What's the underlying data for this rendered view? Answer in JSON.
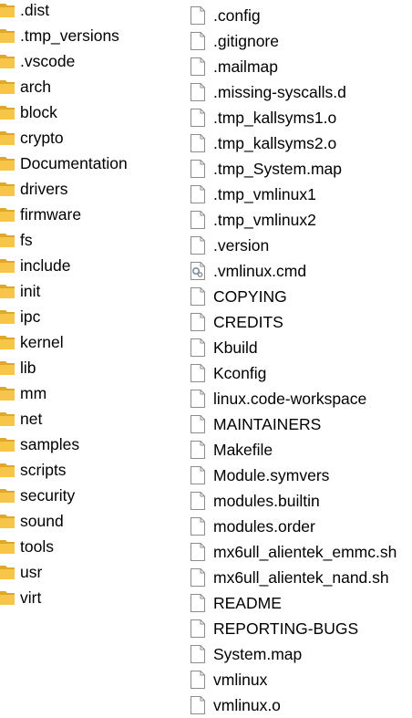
{
  "folders": [
    {
      "name": ".dist",
      "icon": "folder-icon"
    },
    {
      "name": ".tmp_versions",
      "icon": "folder-icon"
    },
    {
      "name": ".vscode",
      "icon": "folder-icon"
    },
    {
      "name": "arch",
      "icon": "folder-icon"
    },
    {
      "name": "block",
      "icon": "folder-icon"
    },
    {
      "name": "crypto",
      "icon": "folder-icon"
    },
    {
      "name": "Documentation",
      "icon": "folder-icon"
    },
    {
      "name": "drivers",
      "icon": "folder-icon"
    },
    {
      "name": "firmware",
      "icon": "folder-icon"
    },
    {
      "name": "fs",
      "icon": "folder-icon"
    },
    {
      "name": "include",
      "icon": "folder-icon"
    },
    {
      "name": "init",
      "icon": "folder-icon"
    },
    {
      "name": "ipc",
      "icon": "folder-icon"
    },
    {
      "name": "kernel",
      "icon": "folder-icon"
    },
    {
      "name": "lib",
      "icon": "folder-icon"
    },
    {
      "name": "mm",
      "icon": "folder-icon"
    },
    {
      "name": "net",
      "icon": "folder-icon"
    },
    {
      "name": "samples",
      "icon": "folder-icon"
    },
    {
      "name": "scripts",
      "icon": "folder-icon"
    },
    {
      "name": "security",
      "icon": "folder-icon"
    },
    {
      "name": "sound",
      "icon": "folder-icon"
    },
    {
      "name": "tools",
      "icon": "folder-icon"
    },
    {
      "name": "usr",
      "icon": "folder-icon"
    },
    {
      "name": "virt",
      "icon": "folder-icon"
    }
  ],
  "files": [
    {
      "name": ".config",
      "icon": "file-icon"
    },
    {
      "name": ".gitignore",
      "icon": "file-icon"
    },
    {
      "name": ".mailmap",
      "icon": "file-icon"
    },
    {
      "name": ".missing-syscalls.d",
      "icon": "file-icon"
    },
    {
      "name": ".tmp_kallsyms1.o",
      "icon": "file-icon"
    },
    {
      "name": ".tmp_kallsyms2.o",
      "icon": "file-icon"
    },
    {
      "name": ".tmp_System.map",
      "icon": "file-icon"
    },
    {
      "name": ".tmp_vmlinux1",
      "icon": "file-icon"
    },
    {
      "name": ".tmp_vmlinux2",
      "icon": "file-icon"
    },
    {
      "name": ".version",
      "icon": "file-icon"
    },
    {
      "name": ".vmlinux.cmd",
      "icon": "cmd-file-icon"
    },
    {
      "name": "COPYING",
      "icon": "file-icon"
    },
    {
      "name": "CREDITS",
      "icon": "file-icon"
    },
    {
      "name": "Kbuild",
      "icon": "file-icon"
    },
    {
      "name": "Kconfig",
      "icon": "file-icon"
    },
    {
      "name": "linux.code-workspace",
      "icon": "file-icon"
    },
    {
      "name": "MAINTAINERS",
      "icon": "file-icon"
    },
    {
      "name": "Makefile",
      "icon": "file-icon"
    },
    {
      "name": "Module.symvers",
      "icon": "file-icon"
    },
    {
      "name": "modules.builtin",
      "icon": "file-icon"
    },
    {
      "name": "modules.order",
      "icon": "file-icon"
    },
    {
      "name": "mx6ull_alientek_emmc.sh",
      "icon": "file-icon"
    },
    {
      "name": "mx6ull_alientek_nand.sh",
      "icon": "file-icon"
    },
    {
      "name": "README",
      "icon": "file-icon"
    },
    {
      "name": "REPORTING-BUGS",
      "icon": "file-icon"
    },
    {
      "name": "System.map",
      "icon": "file-icon"
    },
    {
      "name": "vmlinux",
      "icon": "file-icon"
    },
    {
      "name": "vmlinux.o",
      "icon": "file-icon"
    }
  ],
  "colors": {
    "folder_body": "#f7c548",
    "folder_dark": "#e0a828",
    "file_outline": "#8c8c8c",
    "file_fill": "#ffffff",
    "gear": "#7f8c9a"
  }
}
